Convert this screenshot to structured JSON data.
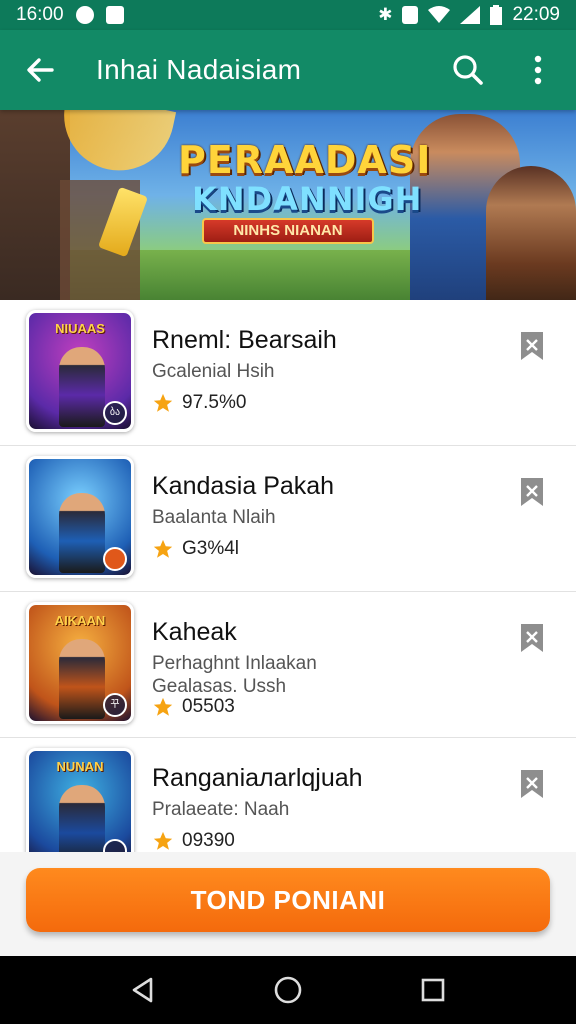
{
  "status_bar": {
    "time": "16:00",
    "right_time": "22:09",
    "icons": [
      "whatsapp-icon",
      "gallery-icon",
      "bluetooth-icon",
      "nfc-icon",
      "wifi-icon",
      "signal-icon",
      "battery-icon"
    ]
  },
  "app_bar": {
    "title": "Inhai Nadaisiam",
    "back_icon": "arrow-left-icon",
    "search_icon": "search-icon",
    "menu_icon": "more-vert-icon"
  },
  "banner": {
    "title_top": "PERAADASI",
    "title_bottom": "KNDANNIGH",
    "ribbon": "NINHS NIANAN",
    "pages": 3,
    "active_page": 1
  },
  "games": [
    {
      "name": "Rneml: Bearsaih",
      "subtitle": "Gcalenial Hsih",
      "rating": "97.5%0",
      "thumb_text": "NIUAAS",
      "badge": "ბა",
      "colors": [
        "#5b2aa8",
        "#c03fbf"
      ]
    },
    {
      "name": "Kandasia Pakah",
      "subtitle": "Baalanta Nlaih",
      "rating": "G3%4l",
      "thumb_text": "",
      "badge": "",
      "colors": [
        "#1e5fb5",
        "#7ad0ff"
      ]
    },
    {
      "name": "Kaheak",
      "subtitle": "Perhaghnt Inlaakan\nGealasas. Ussh",
      "rating": "05503",
      "thumb_text": "AIKAAN",
      "badge": "꾸",
      "colors": [
        "#c0541a",
        "#f6b040"
      ]
    },
    {
      "name": "Ranganiaлarlqjuah",
      "subtitle": "Pralaeate: Naah",
      "rating": "09390",
      "thumb_text": "NUNAN",
      "badge": "",
      "colors": [
        "#1b4a9e",
        "#3fb1e3"
      ]
    }
  ],
  "cta": {
    "label": "TOND PONIANI"
  },
  "colors": {
    "primary": "#128a66",
    "status": "#0d7a5a",
    "accent": "#f46a0c",
    "star": "#f6a312"
  }
}
